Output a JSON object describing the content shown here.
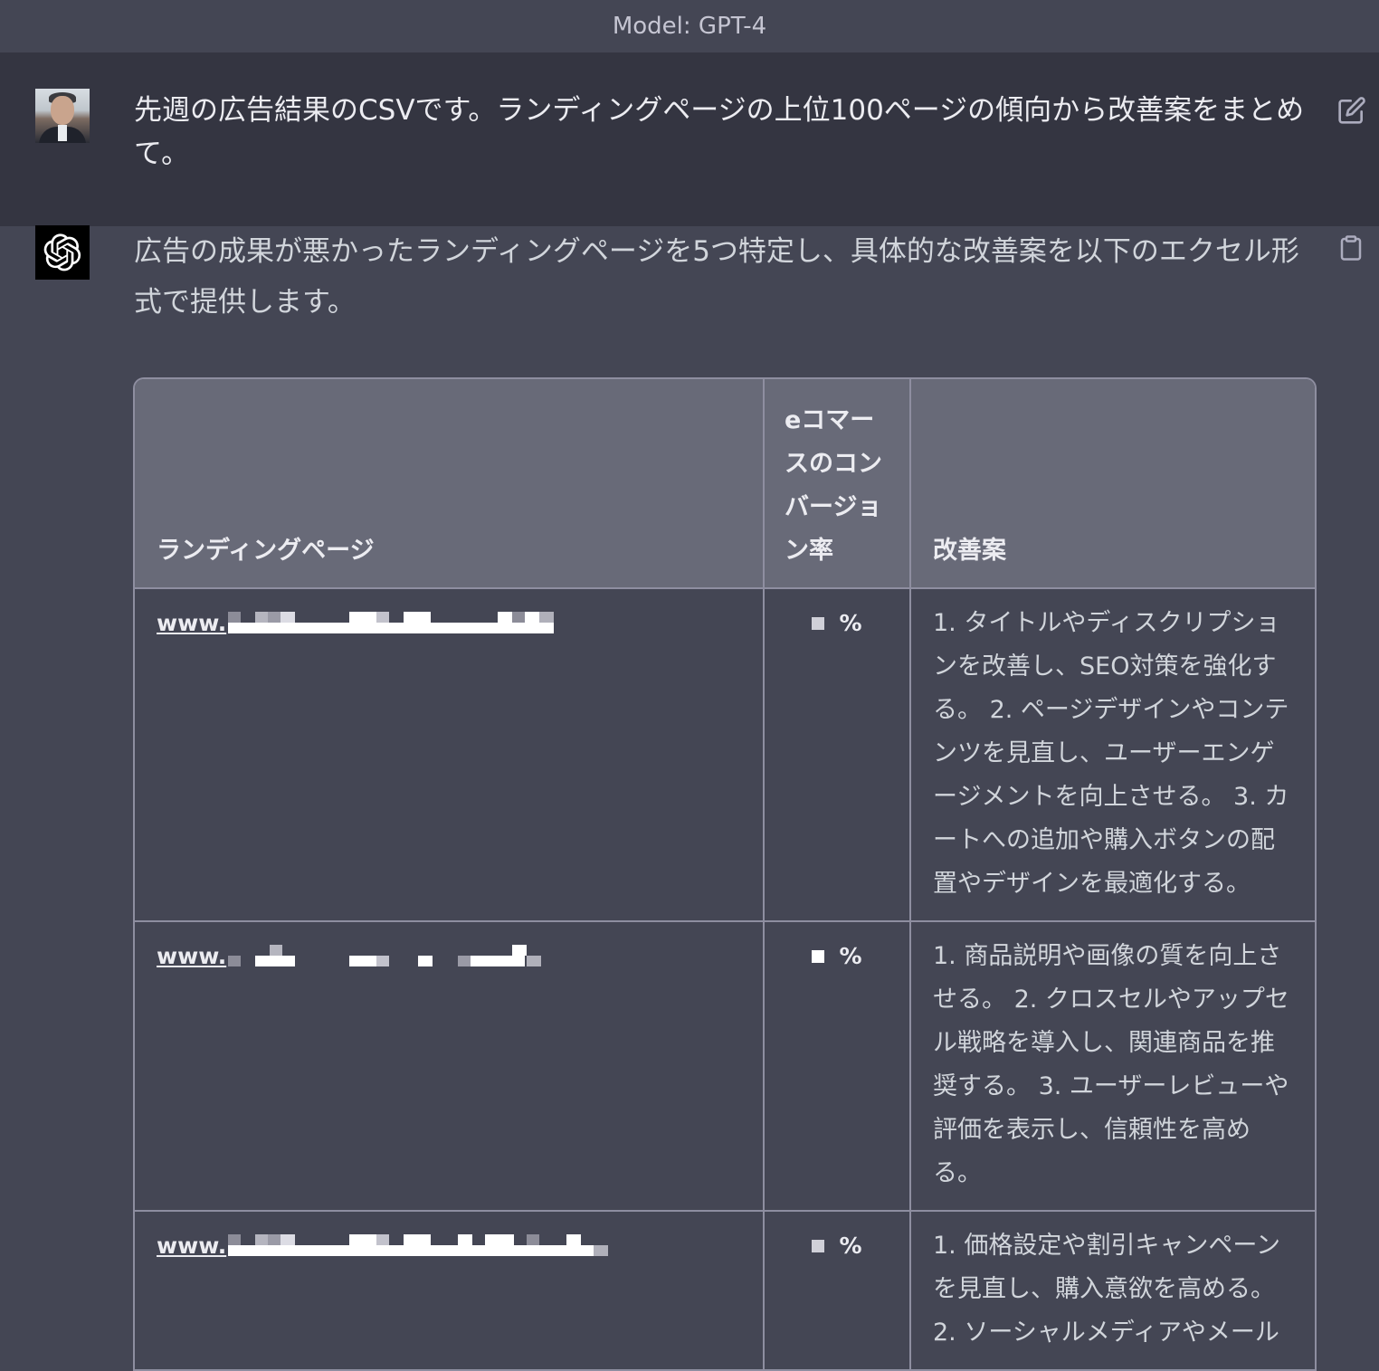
{
  "header": {
    "title": "Model: GPT-4"
  },
  "user_message": {
    "text": "先週の広告結果のCSVです。ランディングページの上位100ページの傾向から改善案をまとめて。"
  },
  "assistant_message": {
    "text": "広告の成果が悪かったランディングページを5つ特定し、具体的な改善案を以下のエクセル形式で提供します。",
    "table": {
      "headers": [
        "ランディングページ",
        "eコマースのコンバージョン率",
        "改善案"
      ],
      "rows": [
        {
          "url": "www.",
          "rate": "%",
          "suggestion": "1. タイトルやディスクリプションを改善し、SEO対策を強化する。 2. ページデザインやコンテンツを見直し、ユーザーエンゲージメントを向上させる。 3. カートへの追加や購入ボタンの配置やデザインを最適化する。"
        },
        {
          "url": "www.",
          "rate": "%",
          "suggestion": "1. 商品説明や画像の質を向上させる。 2. クロスセルやアップセル戦略を導入し、関連商品を推奨する。 3. ユーザーレビューや評価を表示し、信頼性を高める。"
        },
        {
          "url": "www.",
          "rate": "%",
          "suggestion": "1. 価格設定や割引キャンペーンを見直し、購入意欲を高める。 2. ソーシャルメディアやメール"
        }
      ]
    }
  },
  "icons": {
    "edit": "edit-icon",
    "copy": "clipboard-icon",
    "assistant_logo": "openai-logo-icon"
  },
  "colors": {
    "background": "#444654",
    "user_background": "#343541",
    "table_header": "#686a78"
  }
}
